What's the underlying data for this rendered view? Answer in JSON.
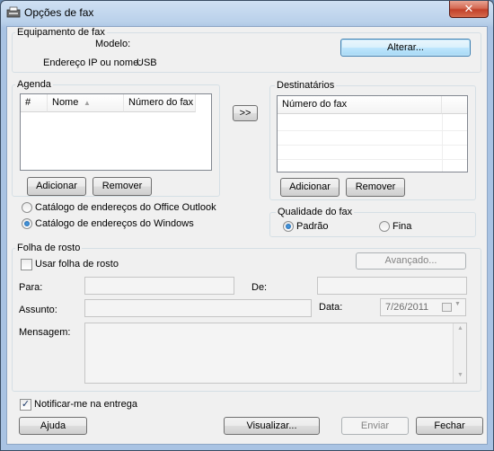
{
  "window": {
    "title": "Opções de fax",
    "close_glyph": "✕"
  },
  "equipment": {
    "group_label": "Equipamento de fax",
    "model_label": "Modelo:",
    "model_value": "",
    "ip_label": "Endereço IP ou nome:",
    "ip_value": "USB",
    "change_button": "Alterar..."
  },
  "agenda": {
    "group_label": "Agenda",
    "columns": [
      "#",
      "Nome",
      "Número do fax"
    ],
    "add_button": "Adicionar",
    "remove_button": "Remover",
    "source_options": [
      {
        "label": "Catálogo de endereços do Office Outlook",
        "selected": false
      },
      {
        "label": "Catálogo de endereços do Windows",
        "selected": true
      }
    ]
  },
  "move_button": ">>",
  "recipients": {
    "group_label": "Destinatários",
    "column": "Número do fax",
    "add_button": "Adicionar",
    "remove_button": "Remover"
  },
  "quality": {
    "group_label": "Qualidade do fax",
    "options": [
      {
        "label": "Padrão",
        "selected": true
      },
      {
        "label": "Fina",
        "selected": false
      }
    ]
  },
  "cover": {
    "group_label": "Folha de rosto",
    "use_cover_label": "Usar folha de rosto",
    "use_cover_checked": false,
    "advanced_button": "Avançado...",
    "to_label": "Para:",
    "from_label": "De:",
    "subject_label": "Assunto:",
    "date_label": "Data:",
    "date_value": "7/26/2011",
    "message_label": "Mensagem:"
  },
  "notify": {
    "label": "Notificar-me na entrega",
    "checked": true
  },
  "footer": {
    "help_button": "Ajuda",
    "preview_button": "Visualizar...",
    "send_button": "Enviar",
    "close_button": "Fechar"
  },
  "colors": {
    "accent": "#3c7fb1",
    "title_bar": "#b9d0ea",
    "close_button": "#c2412a",
    "disabled_text": "#838383"
  }
}
